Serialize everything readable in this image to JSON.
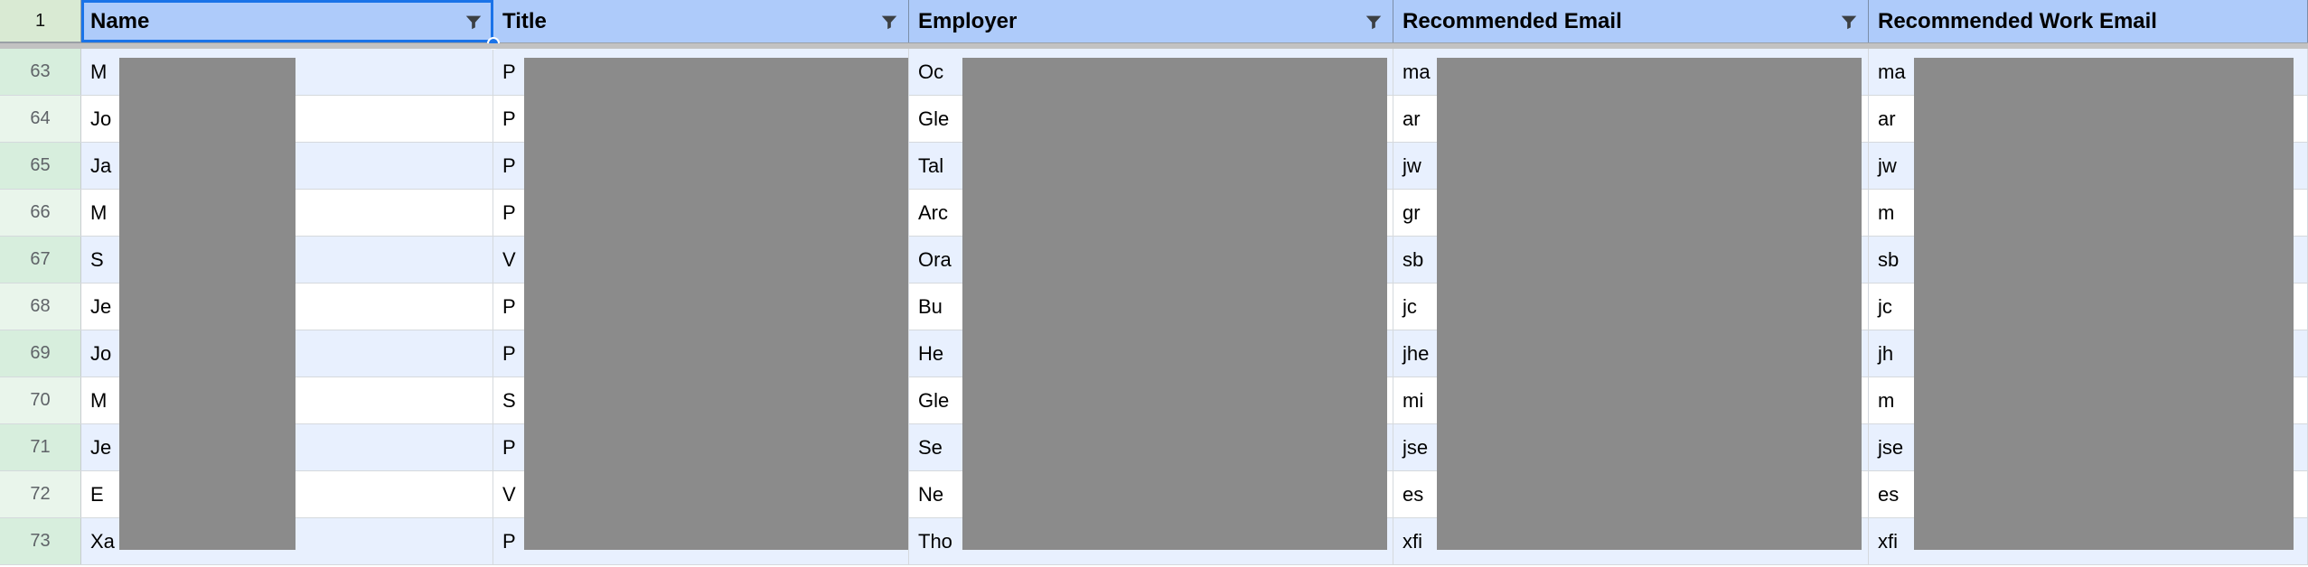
{
  "header": {
    "frozen_row_number": "1",
    "columns": [
      {
        "key": "name",
        "label": "Name",
        "filter": true,
        "selected": true
      },
      {
        "key": "title",
        "label": "Title",
        "filter": true,
        "selected": false
      },
      {
        "key": "employer",
        "label": "Employer",
        "filter": true,
        "selected": false
      },
      {
        "key": "email",
        "label": "Recommended Email",
        "filter": true,
        "selected": false
      },
      {
        "key": "workemail",
        "label": "Recommended Work Email",
        "filter": false,
        "selected": false
      }
    ]
  },
  "rows": [
    {
      "num": "63",
      "name": "M",
      "title": "P",
      "employer": "Oc",
      "email": "ma",
      "workemail": "ma"
    },
    {
      "num": "64",
      "name": "Jo",
      "title": "P",
      "employer": "Gle",
      "email": "ar",
      "workemail": "ar"
    },
    {
      "num": "65",
      "name": "Ja",
      "title": "P",
      "employer": "Tal",
      "email": "jw",
      "workemail": "jw"
    },
    {
      "num": "66",
      "name": "M",
      "title": "P",
      "employer": "Arc",
      "email": "gr",
      "workemail": "m"
    },
    {
      "num": "67",
      "name": "S",
      "title": "V",
      "employer": "Ora",
      "email": "sb",
      "workemail": "sb"
    },
    {
      "num": "68",
      "name": "Je",
      "title": "P",
      "employer": "Bu",
      "email": "jc",
      "workemail": "jc"
    },
    {
      "num": "69",
      "name": "Jo",
      "title": "P",
      "employer": "He",
      "email": "jhe",
      "workemail": "jh"
    },
    {
      "num": "70",
      "name": "M",
      "title": "S",
      "employer": "Gle",
      "email": "mi",
      "workemail": "m"
    },
    {
      "num": "71",
      "name": "Je",
      "title": "P",
      "employer": "Se",
      "email": "jse",
      "workemail": "jse"
    },
    {
      "num": "72",
      "name": "E",
      "title": "V",
      "employer": "Ne",
      "email": "es",
      "workemail": "es"
    },
    {
      "num": "73",
      "name": "Xa",
      "title": "P",
      "employer": "Tho",
      "email": "xfi",
      "workemail": "xfi"
    }
  ],
  "colors": {
    "header_bg": "#aecbfa",
    "selection": "#1a73e8",
    "rownum_bg": "#e8f5e9",
    "stripe_odd": "#e8f0fe",
    "stripe_even": "#ffffff",
    "redaction": "#8b8b8b"
  }
}
